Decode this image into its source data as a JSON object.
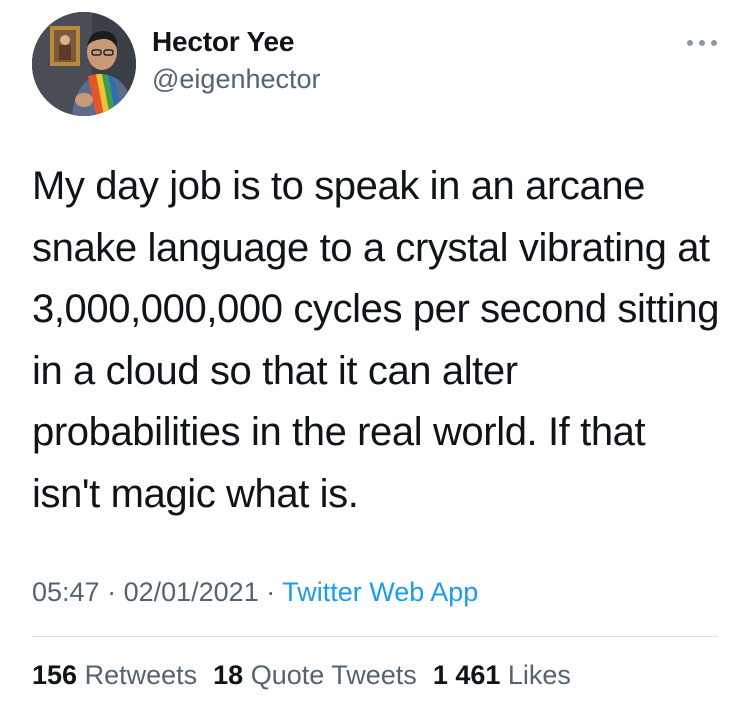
{
  "tweet": {
    "author": {
      "name": "Hector Yee",
      "handle": "@eigenhector"
    },
    "text": "My day job is to speak in an arcane snake language to a crystal vibrating at 3,000,000,000 cycles per second sitting in a cloud so that it can alter probabilities in the real world. If that isn't magic what is.",
    "time": "05:47",
    "date": "02/01/2021",
    "source": "Twitter Web App",
    "separator": " · ",
    "stats": {
      "retweets_count": "156",
      "retweets_label": "Retweets",
      "quotes_count": "18",
      "quotes_label": "Quote Tweets",
      "likes_count": "1 461",
      "likes_label": "Likes"
    }
  },
  "icons": {
    "more": "more-horizontal-icon"
  },
  "colors": {
    "text": "#0f1419",
    "secondary": "#536471",
    "link": "#1d9bf0",
    "divider": "#d9dde0"
  }
}
